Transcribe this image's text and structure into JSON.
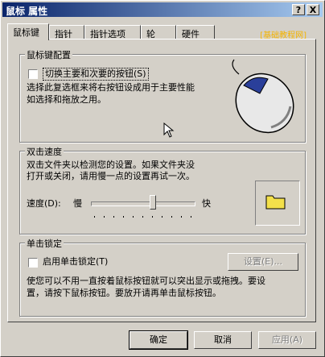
{
  "window": {
    "title": "鼠标 属性"
  },
  "titlebar_buttons": {
    "help": "?",
    "close": "X"
  },
  "tabs": [
    {
      "label": "鼠标键"
    },
    {
      "label": "指针"
    },
    {
      "label": "指针选项"
    },
    {
      "label": "轮"
    },
    {
      "label": "硬件"
    }
  ],
  "watermark": "[基础教程网]",
  "button_config": {
    "legend": "鼠标键配置",
    "checkbox_label": "切换主要和次要的按钮(S)",
    "description_line1": "选择此复选框来将右按钮设成用于主要性能",
    "description_line2": "如选择和拖放之用。"
  },
  "double_click": {
    "legend": "双击速度",
    "description_line1": "双击文件夹以检测您的设置。如果文件夹没",
    "description_line2": "打开或关闭，请用慢一点的设置再试一次。",
    "speed_label": "速度(D):",
    "slow_label": "慢",
    "fast_label": "快",
    "speed_level_fraction": 0.6
  },
  "click_lock": {
    "legend": "单击锁定",
    "checkbox_label": "启用单击锁定(T)",
    "settings_button": "设置(E)...",
    "description_line1": "使您可以不用一直按着鼠标按钮就可以突出显示或拖拽。要设",
    "description_line2": "置，请按下鼠标按钮。要放开请再单击鼠标按钮。"
  },
  "footer": {
    "ok": "确定",
    "cancel": "取消",
    "apply": "应用(A)"
  }
}
